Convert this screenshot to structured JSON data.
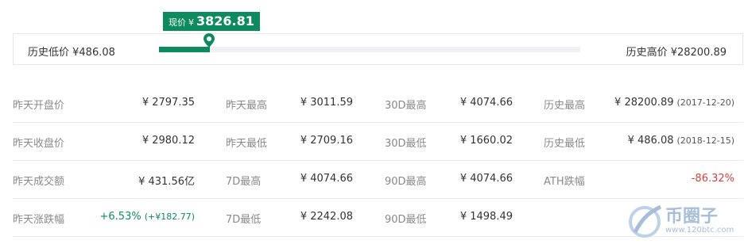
{
  "range": {
    "current_label": "现价",
    "currency": "¥",
    "current_value": "3826.81",
    "low_label": "历史低价 ¥486.08",
    "high_label": "历史高价 ¥28200.89",
    "progress_fraction": 0.12,
    "accent_color": "#0e8a5f"
  },
  "rows": [
    {
      "c0": {
        "label": "昨天开盘价",
        "value": "¥ 2797.35"
      },
      "c1": {
        "label": "昨天最高",
        "value": "¥ 3011.59"
      },
      "c2": {
        "label": "30D最高",
        "value": "¥ 4074.66"
      },
      "c3": {
        "label": "历史最高",
        "value": "¥ 28200.89",
        "date": "(2017-12-20)"
      }
    },
    {
      "c0": {
        "label": "昨天收盘价",
        "value": "¥ 2980.12"
      },
      "c1": {
        "label": "昨天最低",
        "value": "¥ 2709.16"
      },
      "c2": {
        "label": "30D最低",
        "value": "¥ 1660.02"
      },
      "c3": {
        "label": "历史最低",
        "value": "¥ 486.08",
        "date": "(2018-12-15)"
      }
    },
    {
      "c0": {
        "label": "昨天成交额",
        "value": "¥ 431.56亿"
      },
      "c1": {
        "label": "7D最高",
        "value": "¥ 4074.66"
      },
      "c2": {
        "label": "90D最高",
        "value": "¥ 4074.66"
      },
      "c3": {
        "label": "ATH跌幅",
        "value": "-86.32%"
      }
    },
    {
      "c0": {
        "label": "昨天涨跌幅",
        "value": "+6.53%",
        "sub": "(+¥182.77)"
      },
      "c1": {
        "label": "7D最低",
        "value": "¥ 2242.08"
      },
      "c2": {
        "label": "90D最低",
        "value": "¥ 1498.49"
      }
    }
  ],
  "watermark": {
    "text": "币圈子",
    "url": "www.120btc.com"
  }
}
